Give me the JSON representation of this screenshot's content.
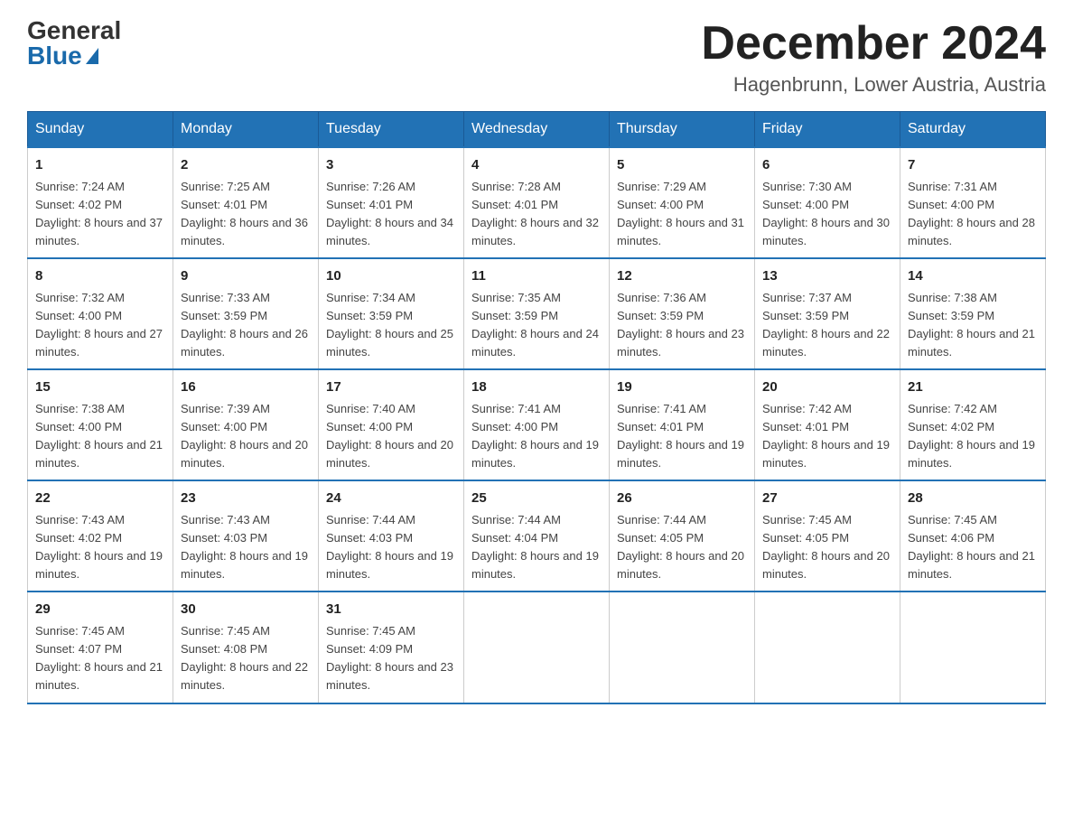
{
  "header": {
    "logo_general": "General",
    "logo_blue": "Blue",
    "month_title": "December 2024",
    "location": "Hagenbrunn, Lower Austria, Austria"
  },
  "days_of_week": [
    "Sunday",
    "Monday",
    "Tuesday",
    "Wednesday",
    "Thursday",
    "Friday",
    "Saturday"
  ],
  "weeks": [
    [
      {
        "day": "1",
        "sunrise": "7:24 AM",
        "sunset": "4:02 PM",
        "daylight": "8 hours and 37 minutes."
      },
      {
        "day": "2",
        "sunrise": "7:25 AM",
        "sunset": "4:01 PM",
        "daylight": "8 hours and 36 minutes."
      },
      {
        "day": "3",
        "sunrise": "7:26 AM",
        "sunset": "4:01 PM",
        "daylight": "8 hours and 34 minutes."
      },
      {
        "day": "4",
        "sunrise": "7:28 AM",
        "sunset": "4:01 PM",
        "daylight": "8 hours and 32 minutes."
      },
      {
        "day": "5",
        "sunrise": "7:29 AM",
        "sunset": "4:00 PM",
        "daylight": "8 hours and 31 minutes."
      },
      {
        "day": "6",
        "sunrise": "7:30 AM",
        "sunset": "4:00 PM",
        "daylight": "8 hours and 30 minutes."
      },
      {
        "day": "7",
        "sunrise": "7:31 AM",
        "sunset": "4:00 PM",
        "daylight": "8 hours and 28 minutes."
      }
    ],
    [
      {
        "day": "8",
        "sunrise": "7:32 AM",
        "sunset": "4:00 PM",
        "daylight": "8 hours and 27 minutes."
      },
      {
        "day": "9",
        "sunrise": "7:33 AM",
        "sunset": "3:59 PM",
        "daylight": "8 hours and 26 minutes."
      },
      {
        "day": "10",
        "sunrise": "7:34 AM",
        "sunset": "3:59 PM",
        "daylight": "8 hours and 25 minutes."
      },
      {
        "day": "11",
        "sunrise": "7:35 AM",
        "sunset": "3:59 PM",
        "daylight": "8 hours and 24 minutes."
      },
      {
        "day": "12",
        "sunrise": "7:36 AM",
        "sunset": "3:59 PM",
        "daylight": "8 hours and 23 minutes."
      },
      {
        "day": "13",
        "sunrise": "7:37 AM",
        "sunset": "3:59 PM",
        "daylight": "8 hours and 22 minutes."
      },
      {
        "day": "14",
        "sunrise": "7:38 AM",
        "sunset": "3:59 PM",
        "daylight": "8 hours and 21 minutes."
      }
    ],
    [
      {
        "day": "15",
        "sunrise": "7:38 AM",
        "sunset": "4:00 PM",
        "daylight": "8 hours and 21 minutes."
      },
      {
        "day": "16",
        "sunrise": "7:39 AM",
        "sunset": "4:00 PM",
        "daylight": "8 hours and 20 minutes."
      },
      {
        "day": "17",
        "sunrise": "7:40 AM",
        "sunset": "4:00 PM",
        "daylight": "8 hours and 20 minutes."
      },
      {
        "day": "18",
        "sunrise": "7:41 AM",
        "sunset": "4:00 PM",
        "daylight": "8 hours and 19 minutes."
      },
      {
        "day": "19",
        "sunrise": "7:41 AM",
        "sunset": "4:01 PM",
        "daylight": "8 hours and 19 minutes."
      },
      {
        "day": "20",
        "sunrise": "7:42 AM",
        "sunset": "4:01 PM",
        "daylight": "8 hours and 19 minutes."
      },
      {
        "day": "21",
        "sunrise": "7:42 AM",
        "sunset": "4:02 PM",
        "daylight": "8 hours and 19 minutes."
      }
    ],
    [
      {
        "day": "22",
        "sunrise": "7:43 AM",
        "sunset": "4:02 PM",
        "daylight": "8 hours and 19 minutes."
      },
      {
        "day": "23",
        "sunrise": "7:43 AM",
        "sunset": "4:03 PM",
        "daylight": "8 hours and 19 minutes."
      },
      {
        "day": "24",
        "sunrise": "7:44 AM",
        "sunset": "4:03 PM",
        "daylight": "8 hours and 19 minutes."
      },
      {
        "day": "25",
        "sunrise": "7:44 AM",
        "sunset": "4:04 PM",
        "daylight": "8 hours and 19 minutes."
      },
      {
        "day": "26",
        "sunrise": "7:44 AM",
        "sunset": "4:05 PM",
        "daylight": "8 hours and 20 minutes."
      },
      {
        "day": "27",
        "sunrise": "7:45 AM",
        "sunset": "4:05 PM",
        "daylight": "8 hours and 20 minutes."
      },
      {
        "day": "28",
        "sunrise": "7:45 AM",
        "sunset": "4:06 PM",
        "daylight": "8 hours and 21 minutes."
      }
    ],
    [
      {
        "day": "29",
        "sunrise": "7:45 AM",
        "sunset": "4:07 PM",
        "daylight": "8 hours and 21 minutes."
      },
      {
        "day": "30",
        "sunrise": "7:45 AM",
        "sunset": "4:08 PM",
        "daylight": "8 hours and 22 minutes."
      },
      {
        "day": "31",
        "sunrise": "7:45 AM",
        "sunset": "4:09 PM",
        "daylight": "8 hours and 23 minutes."
      },
      null,
      null,
      null,
      null
    ]
  ]
}
